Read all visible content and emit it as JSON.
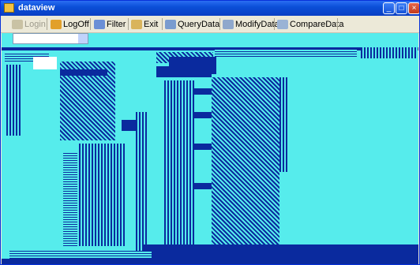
{
  "window": {
    "title": "dataview"
  },
  "toolbar": {
    "buttons": [
      {
        "label": "Login",
        "enabled": false,
        "icon": "login-icon"
      },
      {
        "label": "LogOff",
        "enabled": true,
        "icon": "logoff-icon"
      },
      {
        "label": "Filter",
        "enabled": true,
        "icon": "filter-icon"
      },
      {
        "label": "Exit",
        "enabled": true,
        "icon": "exit-icon"
      },
      {
        "label": "QueryData",
        "enabled": true,
        "icon": "query-icon"
      },
      {
        "label": "ModifyData",
        "enabled": true,
        "icon": "modify-icon"
      },
      {
        "label": "CompareData",
        "enabled": true,
        "icon": "compare-icon"
      }
    ]
  },
  "colors": {
    "accent": "#0a2a9e",
    "background": "#56ecec",
    "titlebar": "#0b4fd8"
  }
}
